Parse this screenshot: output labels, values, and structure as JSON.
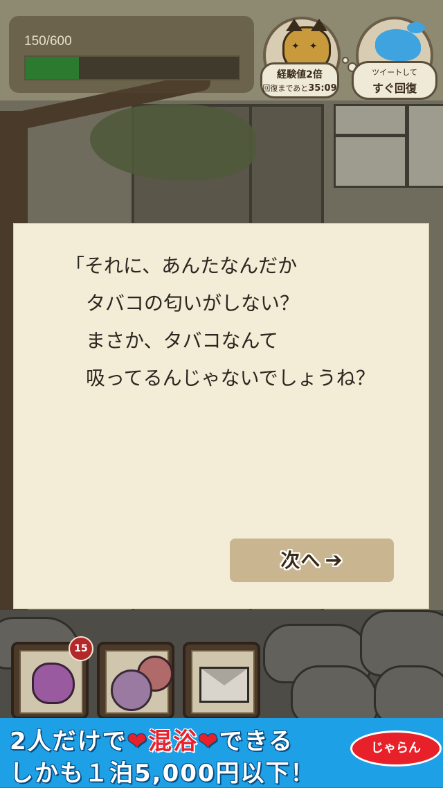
{
  "hud": {
    "xp_text": "150/600",
    "xp_progress": 0.25,
    "exp_boost": {
      "title": "経験値2倍",
      "subtitle": "回復まであと",
      "timer": "35:09",
      "icon": "cat-face-icon"
    },
    "tweet": {
      "title": "ツイートして",
      "action": "すぐ回復",
      "icon": "twitter-bird-icon"
    }
  },
  "dialog": {
    "lines": [
      "「それに、あんたなんだか",
      "タバコの匂いがしない？",
      "まさか、タバコなんて",
      "吸ってるんじゃないでしょうね？"
    ],
    "next_label": "次へ",
    "next_arrow": "➔"
  },
  "items": [
    {
      "name": "dog-item",
      "badge": "15"
    },
    {
      "name": "yarn-item"
    },
    {
      "name": "letter-item"
    }
  ],
  "ad": {
    "line1_a": "2人だけで",
    "heart": "❤",
    "line1_b": "混浴",
    "line1_c": "できる",
    "line2": "しかも１泊5,000円以下！",
    "logo": "じゃらん"
  }
}
